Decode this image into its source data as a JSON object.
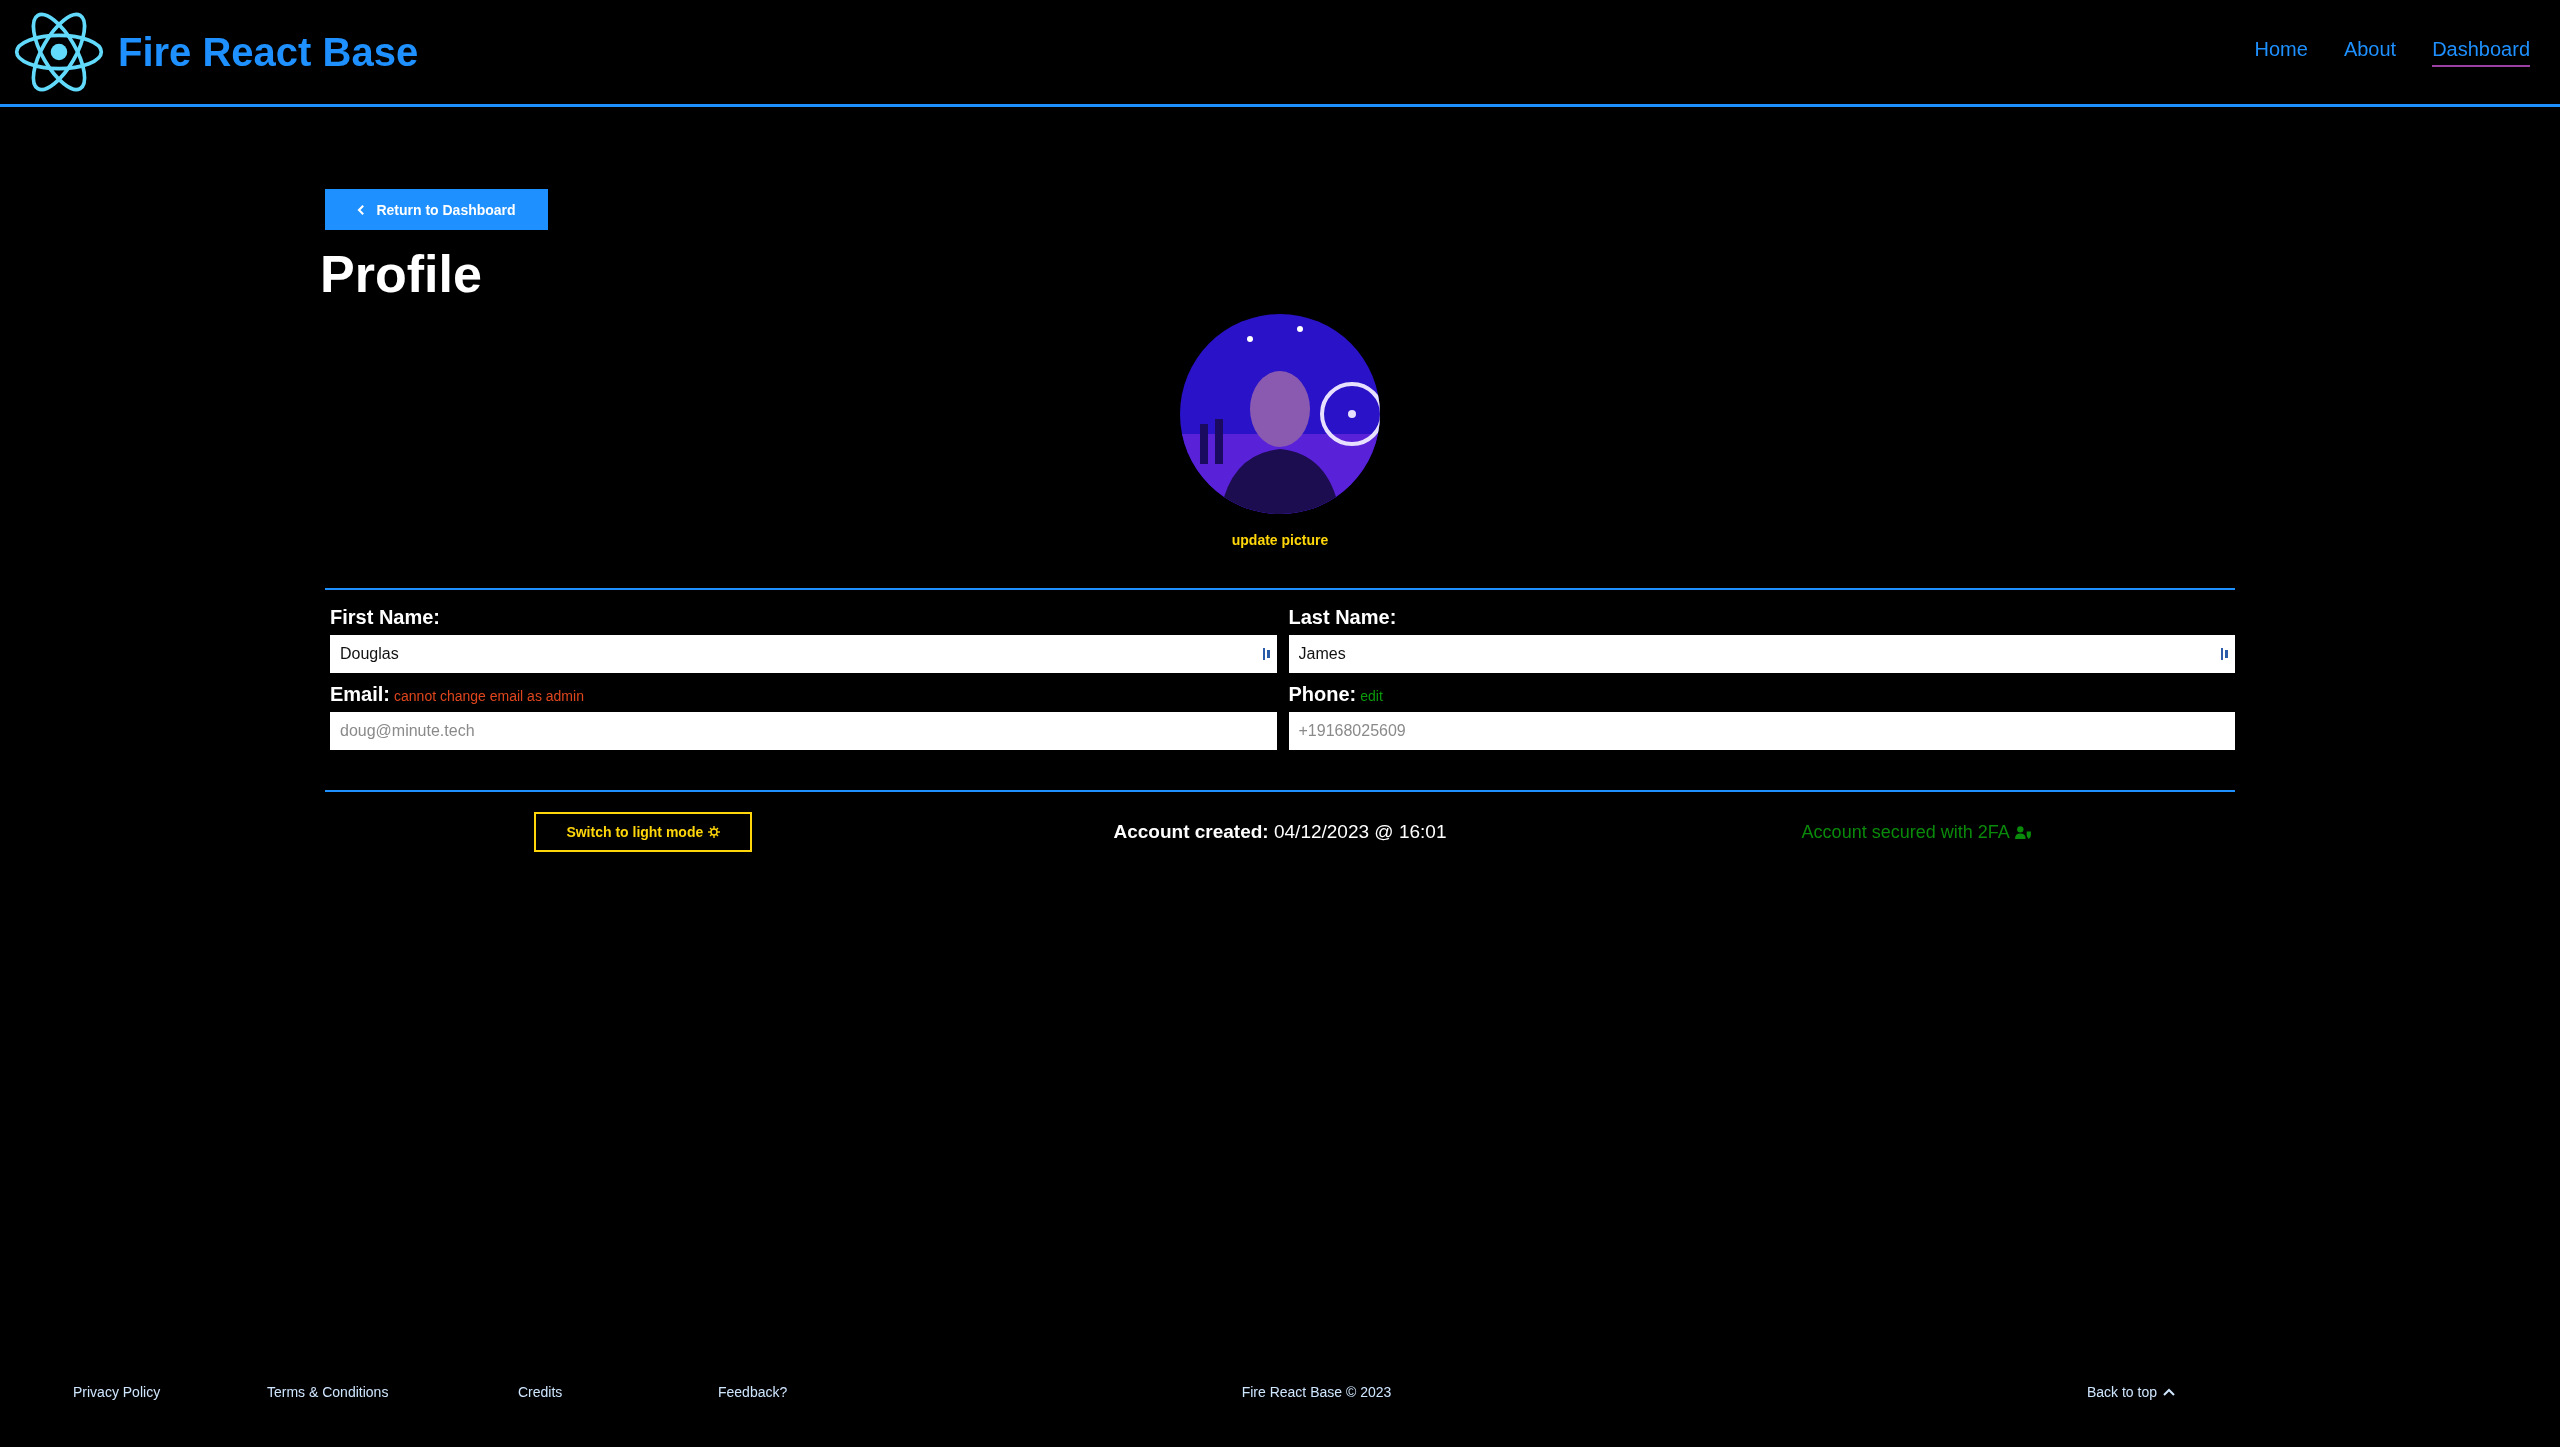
{
  "header": {
    "brand": "Fire React Base",
    "nav": [
      {
        "label": "Home",
        "selected": false
      },
      {
        "label": "About",
        "selected": false
      },
      {
        "label": "Dashboard",
        "selected": true
      }
    ]
  },
  "back_button": {
    "label": "Return to Dashboard"
  },
  "title": "Profile",
  "avatar": {
    "kind": "picture",
    "action": "update picture"
  },
  "fields": [
    {
      "label": "First Name:",
      "value": "Douglas"
    },
    {
      "label": "Last Name:",
      "value": "James"
    },
    {
      "label": "Email:",
      "note": "cannot change email as admin",
      "kind": "warning",
      "placeholder": "doug@minute.tech"
    },
    {
      "label": "Phone:",
      "note": "edit",
      "kind": "link",
      "placeholder": "+19168025609"
    }
  ],
  "theme_button": {
    "label": "Switch to light mode"
  },
  "account_created": {
    "label": "Account created:",
    "value": "04/12/2023 @ 16:01"
  },
  "security": {
    "label": "Account secured with 2FA"
  },
  "footer": {
    "links": [
      "Privacy Policy",
      "Terms & Conditions",
      "Credits",
      "Feedback?"
    ],
    "copyright": "Fire React Base © 2023",
    "back_to_top": "Back to top"
  }
}
